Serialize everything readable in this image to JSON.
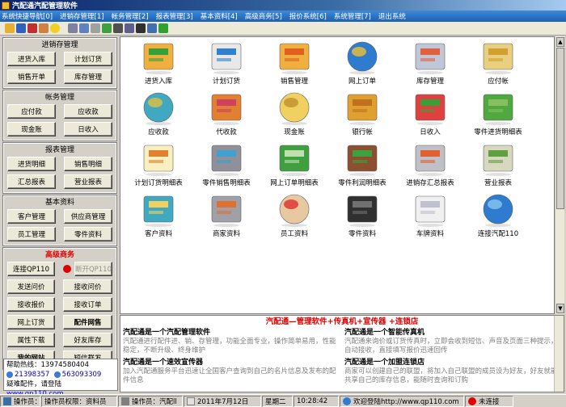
{
  "window": {
    "title": "汽配通汽配管理软件"
  },
  "menu": [
    "系统快捷导航[0]",
    "进销存管理[1]",
    "帐务管理[2]",
    "报表管理[3]",
    "基本资料[4]",
    "高级商务[5]",
    "报价系统[6]",
    "系统管理[7]",
    "退出系统"
  ],
  "sidebar": {
    "sections": [
      {
        "title": "进销存管理",
        "buttons": [
          "进货入库",
          "计划订货",
          "销售开单",
          "库存管理"
        ]
      },
      {
        "title": "帐务管理",
        "buttons": [
          "应付款",
          "应收款",
          "现金账",
          "日收入"
        ]
      },
      {
        "title": "报表管理",
        "buttons": [
          "进货明细",
          "销售明细",
          "汇总报表",
          "营业报表"
        ]
      },
      {
        "title": "基本资料",
        "buttons": [
          "客户管理",
          "供应商管理",
          "员工管理",
          "零件资料"
        ]
      }
    ],
    "advanced": {
      "title": "高级商务",
      "connect": "连接QP110",
      "disconnect": "断开QP110",
      "buttons": [
        "发送问价",
        "接收问价",
        "接收报价",
        "接收订单",
        "网上订货",
        "配件网售",
        "属性下载",
        "好友库存",
        "我的网站",
        "短信群发"
      ]
    },
    "help": {
      "hotline": "帮助热线：13974580404",
      "qq1": "21398357",
      "qq2": "563093309",
      "seek": "疑难配件，请登陆",
      "site": "www.qp110.com"
    }
  },
  "icons": [
    {
      "label": "进货入库",
      "icon": "box-arrow-in-icon"
    },
    {
      "label": "计划订货",
      "icon": "notebook-pen-icon"
    },
    {
      "label": "销售管理",
      "icon": "box-arrow-out-icon"
    },
    {
      "label": "网上订单",
      "icon": "internet-explorer-icon"
    },
    {
      "label": "库存管理",
      "icon": "warehouse-icon"
    },
    {
      "label": "应付帐",
      "icon": "money-bills-icon"
    },
    {
      "label": "应收款",
      "icon": "magnifier-coins-icon"
    },
    {
      "label": "代收款",
      "icon": "gift-boxes-icon"
    },
    {
      "label": "现金账",
      "icon": "coin-stacks-icon"
    },
    {
      "label": "银行帐",
      "icon": "bank-card-icon"
    },
    {
      "label": "日收入",
      "icon": "ledger-book-icon"
    },
    {
      "label": "零件进货明细表",
      "icon": "bottles-icon"
    },
    {
      "label": "计划订货明细表",
      "icon": "notepad-pencil-icon"
    },
    {
      "label": "零件销售明细表",
      "icon": "monitor-chart-icon"
    },
    {
      "label": "网上订单明细表",
      "icon": "billboard-icon"
    },
    {
      "label": "零件利润明细表",
      "icon": "wallet-icon"
    },
    {
      "label": "进销存汇总报表",
      "icon": "printer-report-icon"
    },
    {
      "label": "营业报表",
      "icon": "calculator-icon"
    },
    {
      "label": "客户资料",
      "icon": "magnifier-folder-icon"
    },
    {
      "label": "商家资料",
      "icon": "file-drawer-icon"
    },
    {
      "label": "员工资料",
      "icon": "user-avatar-icon"
    },
    {
      "label": "零件资料",
      "icon": "black-file-icon"
    },
    {
      "label": "车牌资料",
      "icon": "document-icon"
    },
    {
      "label": "连接汽配110",
      "icon": "globe-icon"
    }
  ],
  "news": {
    "headline": "汽配通—管理软件+传真机+宣传器 +连锁店",
    "items": [
      {
        "title": "汽配通是一个汽配管理软件",
        "body": "汽配通进行配件进、销、存管理，功能全面专业，操作简单易用，性能稳定，不断升级、终身维护"
      },
      {
        "title": "汽配通是一个智能传真机",
        "body": "汽配通来询价或订货传真时，立即会收到短信、声音及页面三种提示，自动接收，直接填写报价迅速回传"
      },
      {
        "title": "汽配通是一个速效宣传器",
        "body": "加入汽配通服务平台迅速让全国客户查询到自己的名片信息及发布的配件信息"
      },
      {
        "title": "汽配通是一个加盟连锁店",
        "body": "商家可以创建自己的联盟，将加入自己联盟的成员设为好友，好友就能共享自己的库存信息，能随时查询和订购"
      }
    ]
  },
  "status": {
    "operator": "操作员：",
    "permission": "操作员权限：资料员",
    "operator2": "操作员：汽配ll",
    "date": "2011年7月12日",
    "weekday": "星期二",
    "time": "10:28:42",
    "welcome": "欢迎登陆http://www.qp110.com",
    "connection": "未连接"
  }
}
